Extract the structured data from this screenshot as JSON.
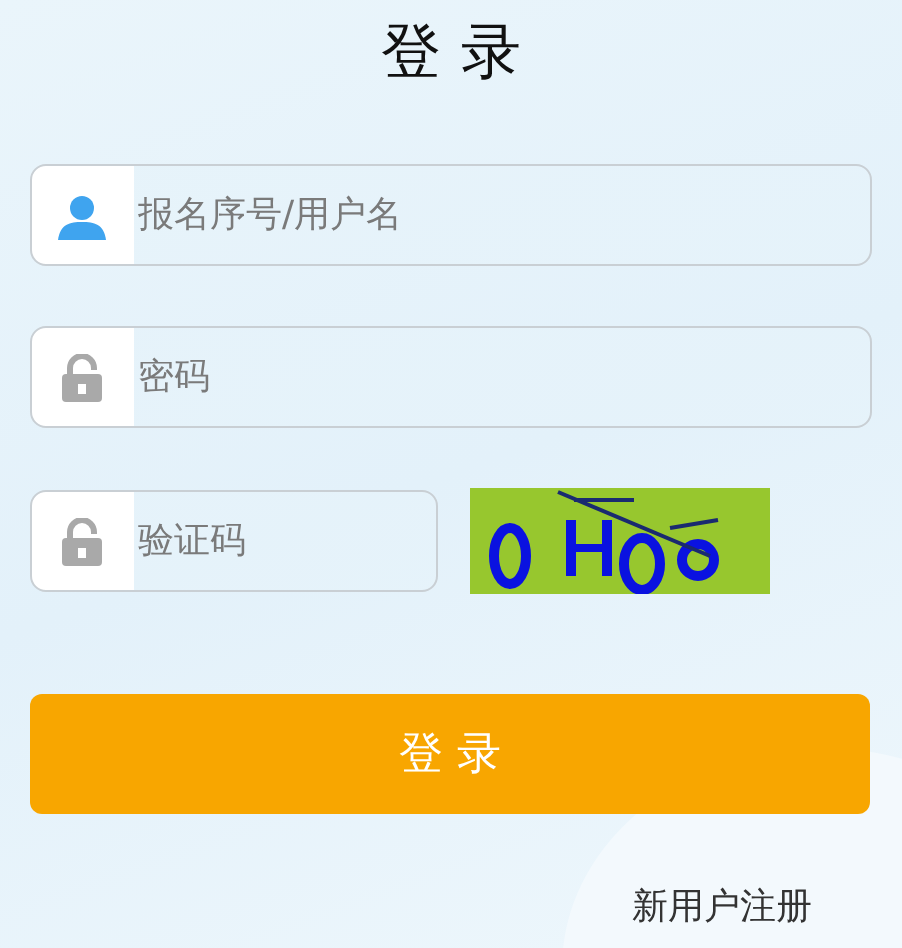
{
  "title": "登 录",
  "fields": [
    {
      "kind": "user",
      "placeholder": "报名序号/用户名"
    },
    {
      "kind": "password",
      "placeholder": "密码"
    },
    {
      "kind": "captcha",
      "placeholder": "验证码"
    }
  ],
  "login_button": "登 录",
  "register_link": "新用户注册"
}
